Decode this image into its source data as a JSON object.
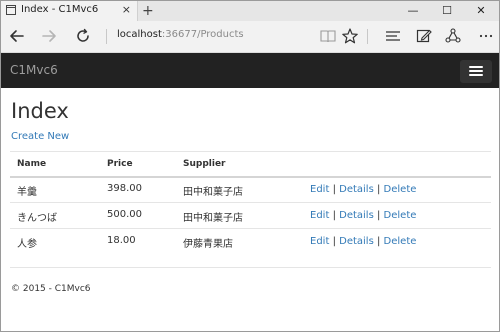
{
  "browser": {
    "tab_title": "Index - C1Mvc6",
    "close_glyph": "×",
    "new_tab_glyph": "+",
    "address_host": "localhost",
    "address_rest": ":36677/Products",
    "win_minimize_glyph": "—",
    "win_maximize_glyph": "☐",
    "win_close_glyph": "✕"
  },
  "navbar": {
    "brand": "C1Mvc6"
  },
  "page": {
    "title": "Index",
    "create_link": "Create New",
    "table": {
      "headers": [
        "Name",
        "Price",
        "Supplier"
      ],
      "rows": [
        {
          "name": "羊羹",
          "price": "398.00",
          "supplier": "田中和菓子店"
        },
        {
          "name": "きんつば",
          "price": "500.00",
          "supplier": "田中和菓子店"
        },
        {
          "name": "人参",
          "price": "18.00",
          "supplier": "伊藤青果店"
        }
      ],
      "actions": {
        "edit": "Edit",
        "details": "Details",
        "delete": "Delete",
        "separator": "|"
      }
    },
    "footer": "© 2015 - C1Mvc6"
  },
  "colors": {
    "navbar_bg": "#222222",
    "brand": "#9d9d9d",
    "link": "#337ab7",
    "chrome_bg": "#f2f2f2"
  }
}
